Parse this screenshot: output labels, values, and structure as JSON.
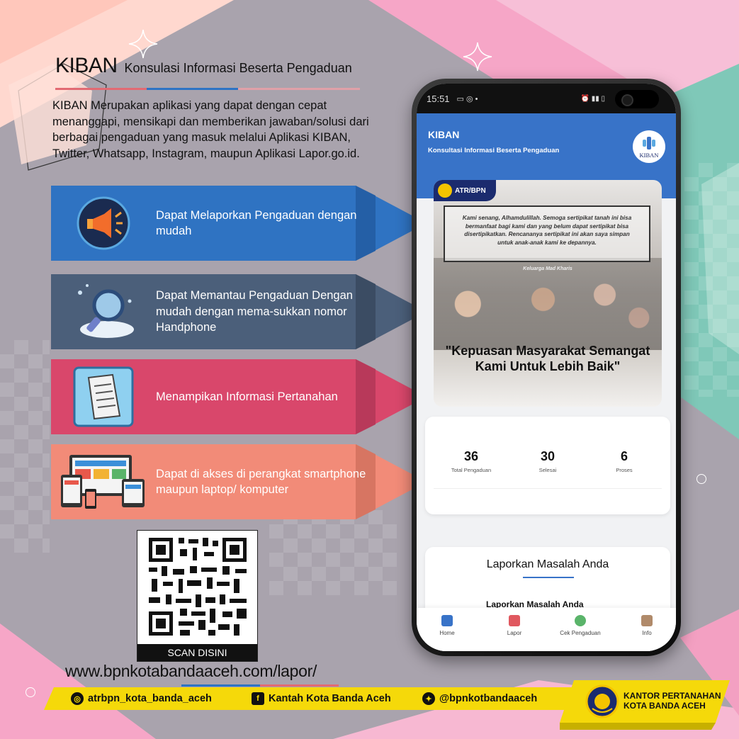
{
  "header": {
    "title": "KIBAN",
    "subtitle": "Konsulasi Informasi Beserta Pengaduan",
    "intro": "KIBAN Merupakan aplikasi yang dapat dengan cepat menanggapi, mensikapi dan memberikan jawaban/solusi dari berbagai pengaduan yang masuk melalui Aplikasi KIBAN, Twitter, Whatsapp, Instagram, maupun Aplikasi Lapor.go.id."
  },
  "features": [
    {
      "label": "Dapat Melaporkan Pengaduan dengan mudah",
      "color": "#2f73c2",
      "icon": "megaphone-icon"
    },
    {
      "label": "Dapat Memantau Pengaduan Dengan mudah dengan mema-sukkan nomor Handphone",
      "color": "#4b5f7a",
      "icon": "magnifier-icon"
    },
    {
      "label": "Menampikan Informasi Pertanahan",
      "color": "#d9476b",
      "icon": "document-icon"
    },
    {
      "label": "Dapat di akses di perangkat smartphone maupun laptop/ komputer",
      "color": "#f28b78",
      "icon": "devices-icon"
    }
  ],
  "qr": {
    "caption": "SCAN DISINI"
  },
  "url": "www.bpnkotabandaaceh.com/lapor/",
  "footer": {
    "instagram": "atrbpn_kota_banda_aceh",
    "facebook": "Kantah Kota Banda Aceh",
    "twitter": "@bpnkotbandaaceh",
    "office_line1": "KANTOR PERTANAHAN",
    "office_line2": "KOTA BANDA ACEH"
  },
  "phone": {
    "status_time": "15:51",
    "app_title": "KIBAN",
    "app_subtitle": "Konsultasi Informasi Beserta Pengaduan",
    "logo_text": "KIBAN",
    "banner": {
      "badge": "ATR/BPN",
      "quote": "Kami senang, Alhamdulillah. Semoga sertipikat tanah ini bisa bermanfaat bagi kami dan yang belum dapat sertipikat bisa disertipikatkan. Rencananya sertipikat ini akan saya simpan untuk anak-anak kami ke depannya.",
      "quote_author": "Keluarga Mad Kharis",
      "headline": "\"Kepuasan Masyarakat Semangat Kami Untuk Lebih Baik\""
    },
    "stats": [
      {
        "value": "36",
        "label": "Total Pengaduan"
      },
      {
        "value": "30",
        "label": "Selesai"
      },
      {
        "value": "6",
        "label": "Proses"
      }
    ],
    "report": {
      "title": "Laporkan Masalah Anda",
      "item": "Laporkan Masalah Anda"
    },
    "nav": [
      {
        "label": "Home",
        "color": "#3873c8"
      },
      {
        "label": "Lapor",
        "color": "#e0585f"
      },
      {
        "label": "Cek Pengaduan",
        "color": "#5ab46a"
      },
      {
        "label": "Info",
        "color": "#b08a6a"
      }
    ]
  }
}
